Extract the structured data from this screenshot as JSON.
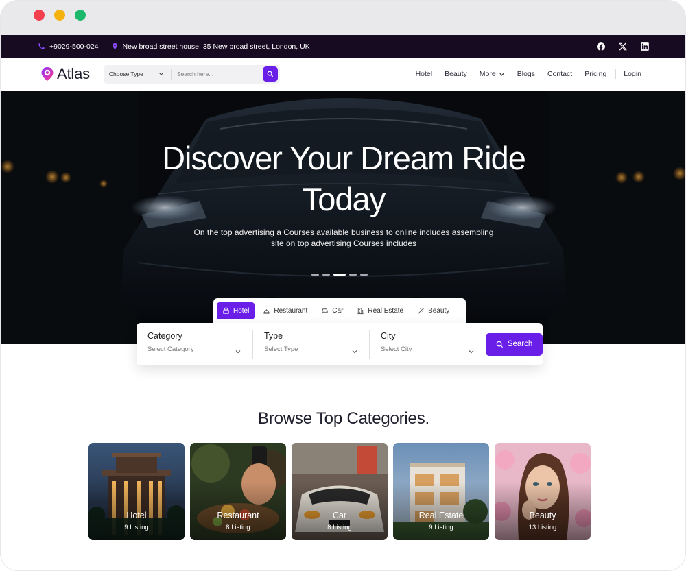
{
  "topbar": {
    "phone": "+9029-500-024",
    "address": "New broad street house, 35 New broad street, London, UK"
  },
  "nav": {
    "logo_text": "Atlas",
    "type_select": "Choose Type",
    "search_placeholder": "Search here...",
    "menu": [
      {
        "label": "Hotel"
      },
      {
        "label": "Beauty"
      },
      {
        "label": "More"
      },
      {
        "label": "Blogs"
      },
      {
        "label": "Contact"
      },
      {
        "label": "Pricing"
      }
    ],
    "login": "Login"
  },
  "hero": {
    "title_line1": "Discover Your Dream Ride",
    "title_line2": "Today",
    "subtitle_line1": "On the top advertising a Courses available business to online includes assembling",
    "subtitle_line2": "site on top advertising Courses includes",
    "slide_count": 5,
    "active_slide": 3
  },
  "tabs": [
    {
      "label": "Hotel",
      "icon": "hotel-icon",
      "active": true
    },
    {
      "label": "Restaurant",
      "icon": "restaurant-icon",
      "active": false
    },
    {
      "label": "Car",
      "icon": "car-icon",
      "active": false
    },
    {
      "label": "Real Estate",
      "icon": "building-icon",
      "active": false
    },
    {
      "label": "Beauty",
      "icon": "beauty-icon",
      "active": false
    }
  ],
  "search_panel": {
    "fields": [
      {
        "label": "Category",
        "value": "Select Category"
      },
      {
        "label": "Type",
        "value": "Select Type"
      },
      {
        "label": "City",
        "value": "Select City"
      }
    ],
    "button": "Search"
  },
  "categories": {
    "title": "Browse Top Categories.",
    "items": [
      {
        "name": "Hotel",
        "count": "9 Listing"
      },
      {
        "name": "Restaurant",
        "count": "8 Listing"
      },
      {
        "name": "Car",
        "count": "8 Listing"
      },
      {
        "name": "Real Estate",
        "count": "9 Listing"
      },
      {
        "name": "Beauty",
        "count": "13 Listing"
      }
    ]
  },
  "colors": {
    "accent": "#6a1fe8",
    "topbar_bg": "#170b22"
  }
}
